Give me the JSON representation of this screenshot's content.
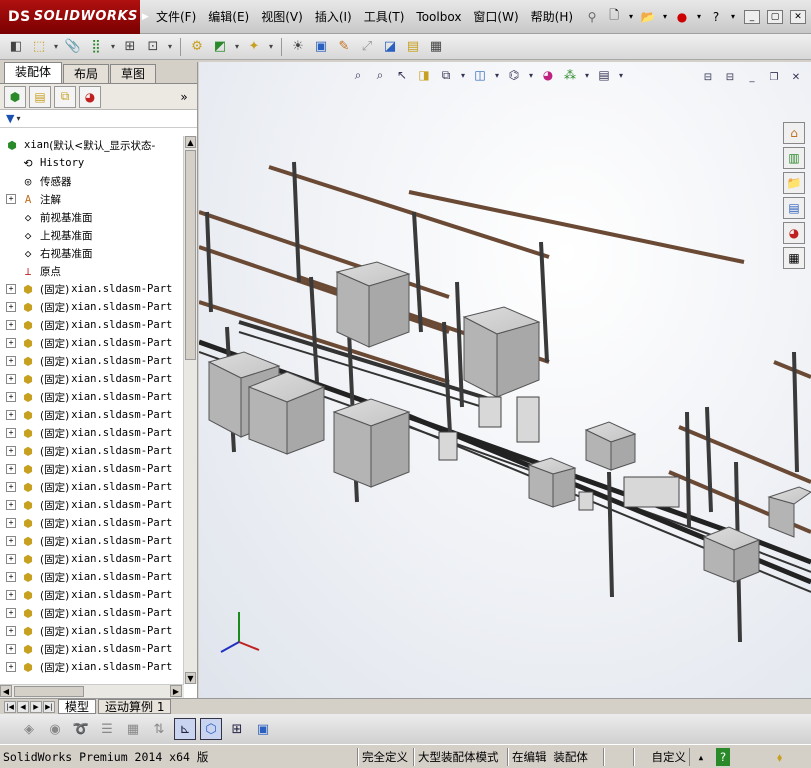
{
  "app": {
    "logo_mark": "DS",
    "logo_text": "SOLIDWORKS",
    "accent": "#9a0a0a"
  },
  "menu": {
    "items": [
      "文件(F)",
      "编辑(E)",
      "视图(V)",
      "插入(I)",
      "工具(T)",
      "Toolbox",
      "窗口(W)",
      "帮助(H)"
    ]
  },
  "menu_icons": [
    "pin-icon",
    "new-document-icon",
    "open-icon",
    "traffic-light-icon",
    "help-icon"
  ],
  "window_controls": {
    "minimize": "_",
    "restore": "▢",
    "close": "✕"
  },
  "panel": {
    "tabs": [
      "装配体",
      "布局",
      "草图"
    ],
    "active_tab": "装配体",
    "tree": {
      "root": {
        "name": "xian",
        "config": " (默认<默认_显示状态-"
      },
      "items": [
        "History",
        "传感器",
        "注解",
        "前视基准面",
        "上视基准面",
        "右视基准面",
        "原点"
      ],
      "part_prefix": "(固定)",
      "part_name": "xian.sldasm-Part",
      "part_count": 22
    }
  },
  "viewport": {
    "background": "#eef1f6"
  },
  "bottom_tabs": {
    "items": [
      "模型",
      "运动算例 1"
    ],
    "active": "模型"
  },
  "status": {
    "version": "SolidWorks Premium 2014 x64 版",
    "definition": "完全定义",
    "mode": "大型装配体模式",
    "editing": "在编辑 装配体",
    "units": "自定义",
    "units_arrow": "▴",
    "help": "?"
  }
}
